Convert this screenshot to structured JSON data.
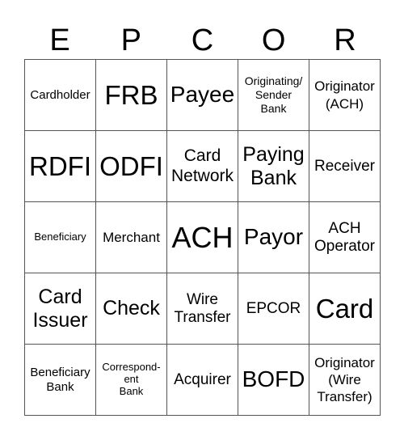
{
  "header": [
    "E",
    "P",
    "C",
    "O",
    "R"
  ],
  "cells": [
    "Cardholder",
    "FRB",
    "Payee",
    "Originating/\nSender\nBank",
    "Originator\n(ACH)",
    "RDFI",
    "ODFI",
    "Card\nNetwork",
    "Paying\nBank",
    "Receiver",
    "Beneficiary",
    "Merchant",
    "ACH",
    "Payor",
    "ACH\nOperator",
    "Card\nIssuer",
    "Check",
    "Wire\nTransfer",
    "EPCOR",
    "Card",
    "Beneficiary\nBank",
    "Correspond-\nent\nBank",
    "Acquirer",
    "BOFD",
    "Originator\n(Wire\nTransfer)"
  ]
}
